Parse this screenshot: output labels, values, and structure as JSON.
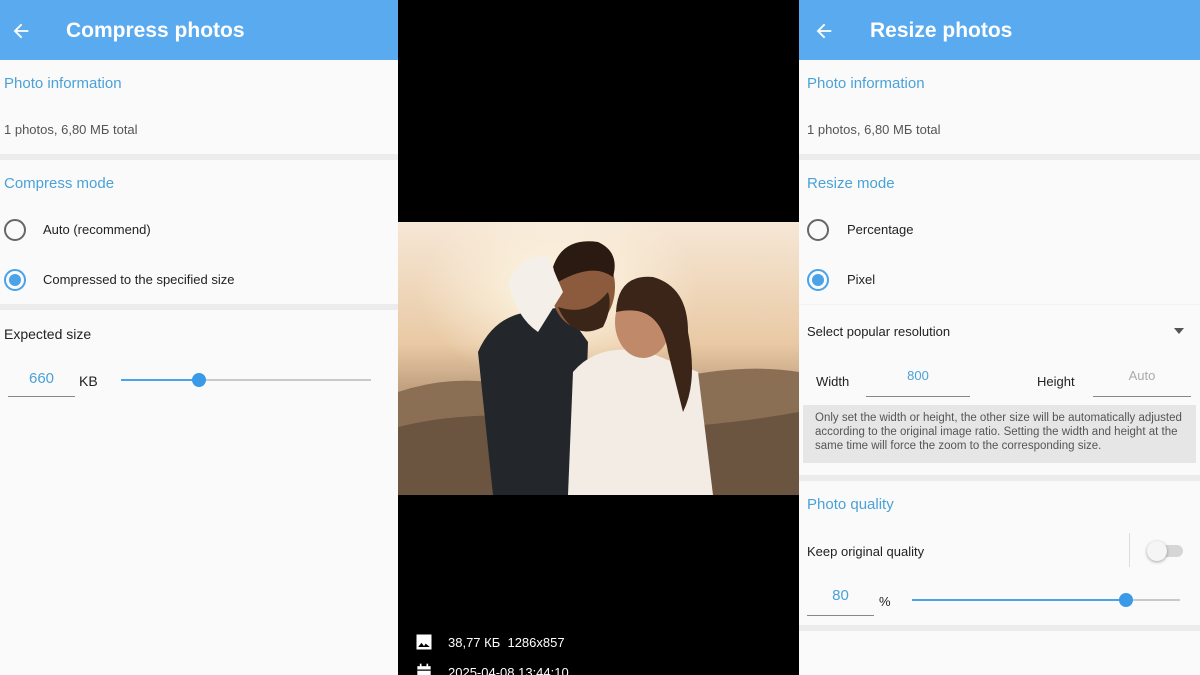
{
  "left": {
    "title": "Compress photos",
    "photo_info": {
      "heading": "Photo information",
      "summary": "1 photos, 6,80 МБ total"
    },
    "compress_mode": {
      "heading": "Compress mode",
      "options": [
        "Auto (recommend)",
        "Compressed to the specified size"
      ],
      "selected_index": 1
    },
    "expected_size": {
      "label": "Expected size",
      "value": "660",
      "unit": "KB",
      "slider_fraction": 0.31
    }
  },
  "middle": {
    "file_info": "38,77 КБ  1286x857",
    "date": "2025-04-08 13:44:10"
  },
  "right": {
    "title": "Resize photos",
    "photo_info": {
      "heading": "Photo information",
      "summary": "1 photos, 6,80 МБ total"
    },
    "resize_mode": {
      "heading": "Resize mode",
      "options": [
        "Percentage",
        "Pixel"
      ],
      "selected_index": 1
    },
    "popular_resolution": "Select popular resolution",
    "width": {
      "label": "Width",
      "value": "800"
    },
    "height": {
      "label": "Height",
      "placeholder": "Auto"
    },
    "note": "Only set the width or height, the other size will be automatically adjusted according to the original image ratio. Setting the width and height at the same time will force the zoom to the corresponding size.",
    "photo_quality": {
      "heading": "Photo quality",
      "keep_original_label": "Keep original quality",
      "keep_original": false,
      "value": "80",
      "unit": "%",
      "slider_fraction": 0.8
    }
  },
  "colors": {
    "appbar": "#5aaaf0",
    "accent": "#4aa2e8",
    "section_title": "#4aa2d8"
  }
}
